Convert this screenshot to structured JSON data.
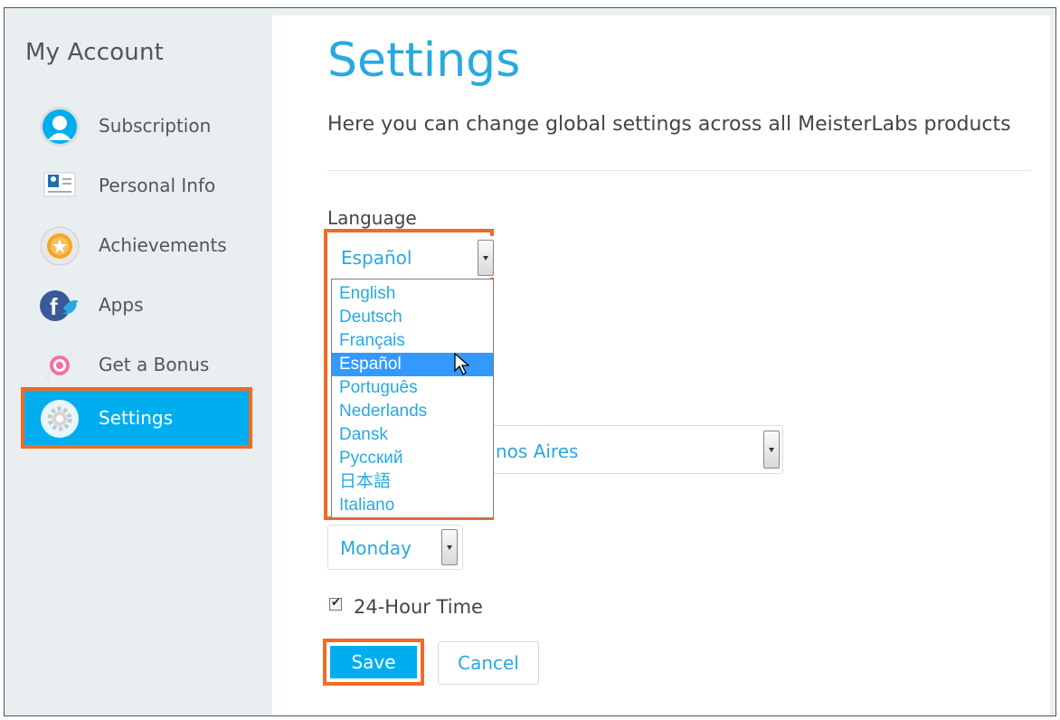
{
  "sidebar": {
    "title": "My Account",
    "items": [
      {
        "label": "Subscription",
        "icon": "user-icon",
        "active": false
      },
      {
        "label": "Personal Info",
        "icon": "id-card-icon",
        "active": false
      },
      {
        "label": "Achievements",
        "icon": "medal-icon",
        "active": false
      },
      {
        "label": "Apps",
        "icon": "facebook-twitter-icon",
        "active": false
      },
      {
        "label": "Get a Bonus",
        "icon": "candy-icon",
        "active": false
      },
      {
        "label": "Settings",
        "icon": "gear-icon",
        "active": true
      }
    ]
  },
  "main": {
    "title": "Settings",
    "subtitle": "Here you can change global settings across all MeisterLabs products",
    "language": {
      "label": "Language",
      "value": "Español",
      "options": [
        "English",
        "Deutsch",
        "Français",
        "Español",
        "Português",
        "Nederlands",
        "Dansk",
        "Русский",
        "日本語",
        "Italiano"
      ],
      "highlighted": "Español"
    },
    "timezone": {
      "value_visible": "nos Aires"
    },
    "week_start": {
      "value": "Monday"
    },
    "time_format": {
      "label": "24-Hour Time",
      "checked": true
    },
    "buttons": {
      "save": "Save",
      "cancel": "Cancel"
    }
  },
  "colors": {
    "accent": "#00aeef",
    "title_blue": "#27a9e1",
    "highlight_outline": "#f26a26",
    "selected_option": "#3399ff",
    "sidebar_bg": "#e9eef1"
  }
}
